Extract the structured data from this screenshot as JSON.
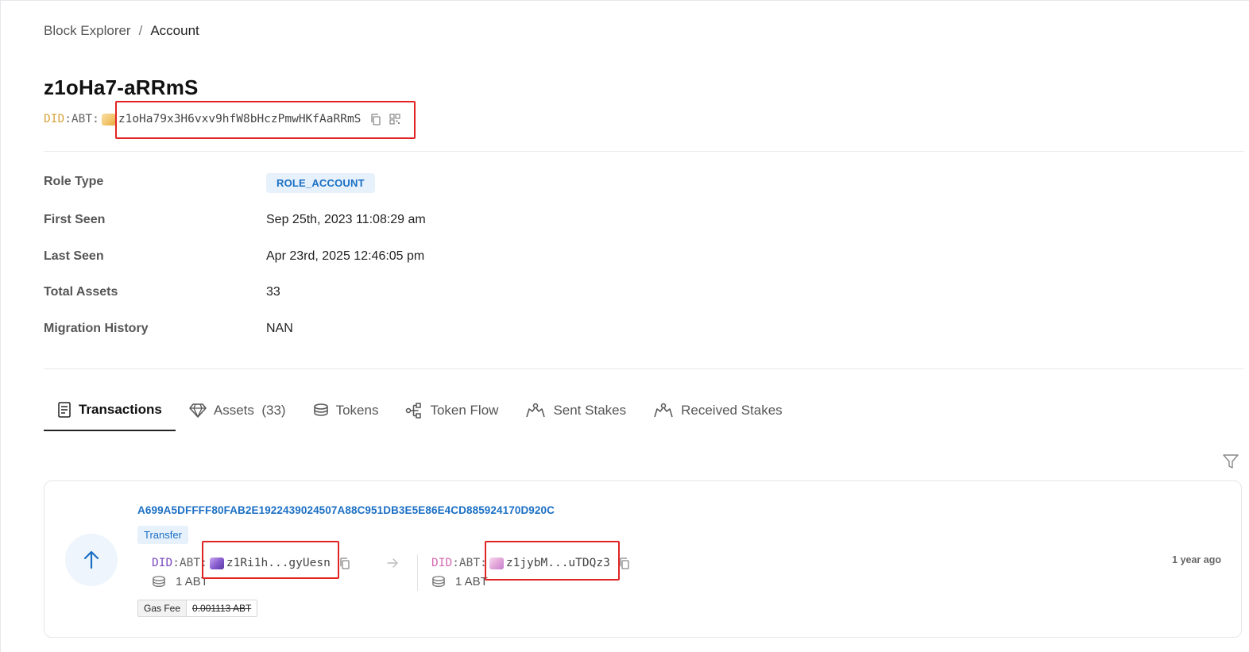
{
  "breadcrumb": {
    "root": "Block Explorer",
    "separator": "/",
    "current": "Account"
  },
  "account": {
    "title": "z1oHa7-aRRmS",
    "did_prefix_did": "DID",
    "did_prefix_rest": ":ABT:",
    "did_address": "z1oHa79x3H6vxv9hfW8bHczPmwHKfAaRRmS",
    "avatar_color": "#f3c873",
    "copy_icon": "copy-icon",
    "qr_icon": "qrcode-icon"
  },
  "info": {
    "role_type": {
      "label": "Role Type",
      "value": "ROLE_ACCOUNT"
    },
    "first_seen": {
      "label": "First Seen",
      "value": "Sep 25th, 2023 11:08:29 am"
    },
    "last_seen": {
      "label": "Last Seen",
      "value": "Apr 23rd, 2025 12:46:05 pm"
    },
    "total_assets": {
      "label": "Total Assets",
      "value": "33"
    },
    "migration_history": {
      "label": "Migration History",
      "value": "NAN"
    }
  },
  "tabs": [
    {
      "label": "Transactions",
      "icon": "receipt-icon",
      "active": true
    },
    {
      "label": "Assets  (33)",
      "icon": "diamond-icon",
      "active": false
    },
    {
      "label": "Tokens",
      "icon": "coins-icon",
      "active": false
    },
    {
      "label": "Token Flow",
      "icon": "flow-icon",
      "active": false
    },
    {
      "label": "Sent Stakes",
      "icon": "stake-icon",
      "active": false
    },
    {
      "label": "Received Stakes",
      "icon": "stake-icon",
      "active": false
    }
  ],
  "transaction": {
    "hash": "A699A5DFFFF80FAB2E1922439024507A88C951DB3E5E86E4CD885924170D920C",
    "type": "Transfer",
    "direction_icon": "arrow-up-icon",
    "from": {
      "did_prefix_did": "DID",
      "did_prefix_rest": ":ABT:",
      "address": "z1Ri1h...gyUesn",
      "amount": "1 ABT",
      "avatar_color": "#8a5fd0"
    },
    "to": {
      "did_prefix_did": "DID",
      "did_prefix_rest": ":ABT:",
      "address": "z1jybM...uTDQz3",
      "amount": "1 ABT",
      "avatar_color": "#e3a6d8"
    },
    "gas_fee_label": "Gas Fee",
    "gas_fee_value": "0.001113 ABT",
    "time_ago": "1 year ago"
  },
  "colors": {
    "accent": "#1a6fc4",
    "highlight_box": "#e02424",
    "did_gold": "#d9a441"
  }
}
